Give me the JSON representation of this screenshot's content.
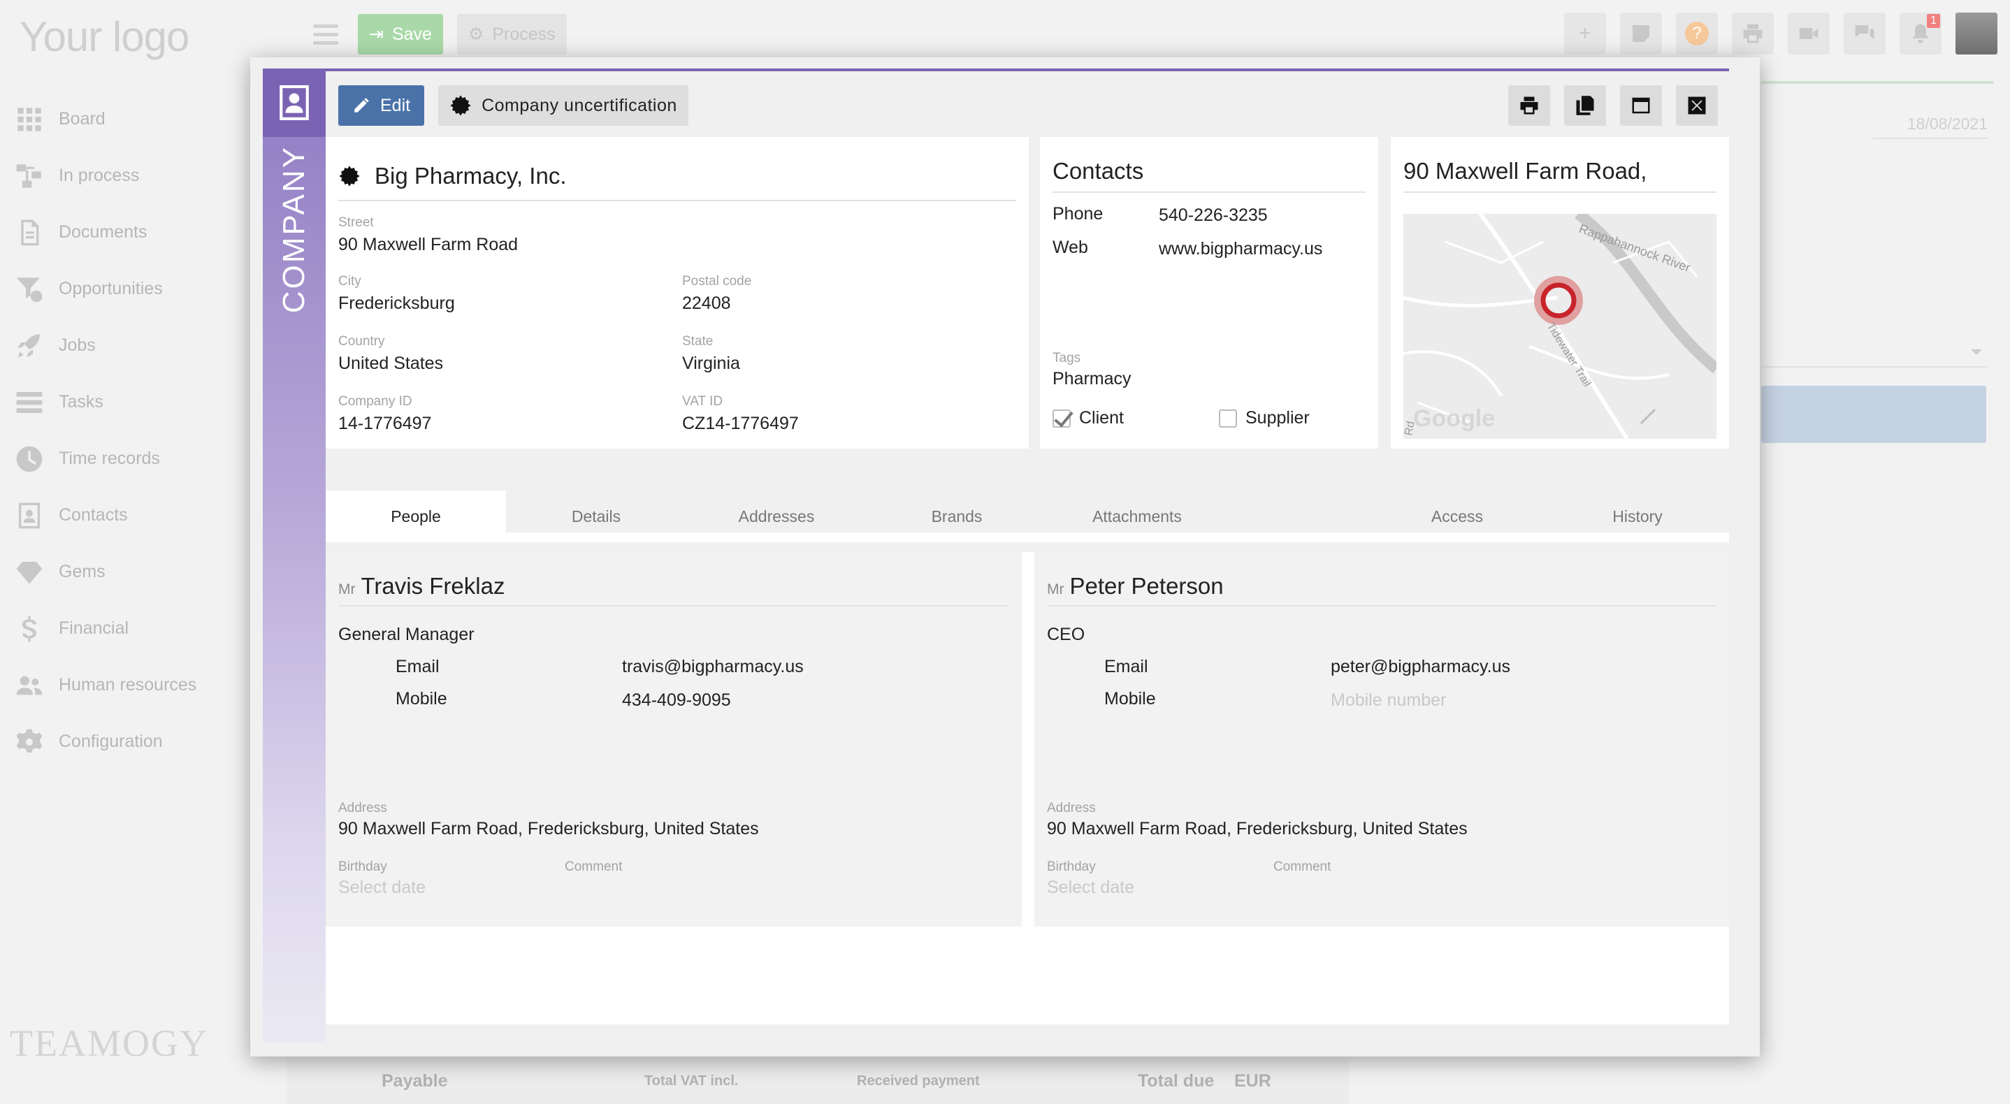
{
  "app": {
    "logo": "Your logo",
    "brand": "TEAMOGY",
    "nav": [
      {
        "label": "Board",
        "icon": "grid-icon"
      },
      {
        "label": "In process",
        "icon": "process-icon"
      },
      {
        "label": "Documents",
        "icon": "document-icon"
      },
      {
        "label": "Opportunities",
        "icon": "funnel-icon"
      },
      {
        "label": "Jobs",
        "icon": "rocket-icon"
      },
      {
        "label": "Tasks",
        "icon": "tasks-icon"
      },
      {
        "label": "Time records",
        "icon": "clock-icon"
      },
      {
        "label": "Contacts",
        "icon": "contact-card-icon"
      },
      {
        "label": "Gems",
        "icon": "gem-icon"
      },
      {
        "label": "Financial",
        "icon": "dollar-icon"
      },
      {
        "label": "Human resources",
        "icon": "people-icon"
      },
      {
        "label": "Configuration",
        "icon": "gear-icon"
      }
    ],
    "toolbar": {
      "save_label": "Save",
      "process_label": "Process"
    },
    "notification_count": "1",
    "right_date": "18/08/2021",
    "footer": {
      "payable": "Payable",
      "total_vat": "Total VAT incl.",
      "received": "Received payment",
      "total_due": "Total due",
      "currency": "EUR"
    }
  },
  "modal": {
    "strip_label": "COMPANY",
    "edit_label": "Edit",
    "uncert_label": "Company uncertification",
    "company": {
      "name": "Big Pharmacy, Inc.",
      "street_label": "Street",
      "street": "90  Maxwell Farm Road",
      "city_label": "City",
      "city": "Fredericksburg",
      "postal_label": "Postal code",
      "postal": "22408",
      "country_label": "Country",
      "country": "United States",
      "state_label": "State",
      "state": "Virginia",
      "company_id_label": "Company ID",
      "company_id": "14-1776497",
      "vat_label": "VAT ID",
      "vat": "CZ14-1776497"
    },
    "contacts": {
      "title": "Contacts",
      "phone_label": "Phone",
      "phone": "540-226-3235",
      "web_label": "Web",
      "web": "www.bigpharmacy.us",
      "tags_label": "Tags",
      "tags": "Pharmacy",
      "client_label": "Client",
      "client_checked": true,
      "supplier_label": "Supplier",
      "supplier_checked": false
    },
    "map": {
      "address": "90 Maxwell Farm Road,",
      "road1": "Rappahannock River",
      "road2": "Tidewater Trail",
      "road3": "Rd",
      "google": "Google"
    },
    "tabs": [
      "People",
      "Details",
      "Addresses",
      "Brands",
      "Attachments",
      "Access",
      "History"
    ],
    "people": [
      {
        "title": "Mr",
        "name": "Travis Freklaz",
        "role": "General Manager",
        "email_label": "Email",
        "email": "travis@bigpharmacy.us",
        "mobile_label": "Mobile",
        "mobile": "434-409-9095",
        "mobile_placeholder": "Mobile number",
        "address_label": "Address",
        "address": "90 Maxwell Farm Road, Fredericksburg, United States",
        "birthday_label": "Birthday",
        "birthday_placeholder": "Select date",
        "comment_label": "Comment"
      },
      {
        "title": "Mr",
        "name": "Peter Peterson",
        "role": "CEO",
        "email_label": "Email",
        "email": "peter@bigpharmacy.us",
        "mobile_label": "Mobile",
        "mobile": "",
        "mobile_placeholder": "Mobile number",
        "address_label": "Address",
        "address": "90 Maxwell Farm Road, Fredericksburg, United States",
        "birthday_label": "Birthday",
        "birthday_placeholder": "Select date",
        "comment_label": "Comment"
      }
    ]
  }
}
